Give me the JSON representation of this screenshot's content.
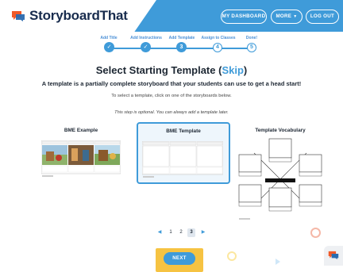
{
  "brand": {
    "name": "StoryboardThat",
    "colors": {
      "primary": "#3f9bd9",
      "next_highlight": "#f6c342"
    }
  },
  "header": {
    "dashboard_label": "MY DASHBOARD",
    "more_label": "MORE",
    "more_icon": "caret-down-icon",
    "logout_label": "LOG OUT"
  },
  "steps": [
    {
      "label": "Add Title",
      "marker": "✓",
      "state": "done"
    },
    {
      "label": "Add Instructions",
      "marker": "✓",
      "state": "done"
    },
    {
      "label": "Add Template",
      "marker": "3",
      "state": "current"
    },
    {
      "label": "Assign to Classes",
      "marker": "4",
      "state": "upcoming"
    },
    {
      "label": "Done!",
      "marker": "5",
      "state": "upcoming"
    }
  ],
  "page": {
    "title_main": "Select Starting Template (",
    "title_skip": "Skip",
    "title_close": ")",
    "subtitle": "A template is a partially complete storyboard that your students can use to get a head start!",
    "instruction": "To select a template, click on one of the storyboards below.",
    "note": "This step is optional. You can always add a template later."
  },
  "templates": [
    {
      "title": "BME Example",
      "headers": [
        "BEGINNING",
        "MIDDLE",
        "END"
      ],
      "selected": false
    },
    {
      "title": "BME Template",
      "headers": [
        "BEGINNING",
        "MIDDLE",
        "END"
      ],
      "selected": true
    },
    {
      "title": "Template Vocabulary",
      "selected": false
    }
  ],
  "pagination": {
    "prev": "◀",
    "pages": [
      "1",
      "2",
      "3"
    ],
    "current": "3",
    "next": "▶"
  },
  "next_button": "NEXT"
}
